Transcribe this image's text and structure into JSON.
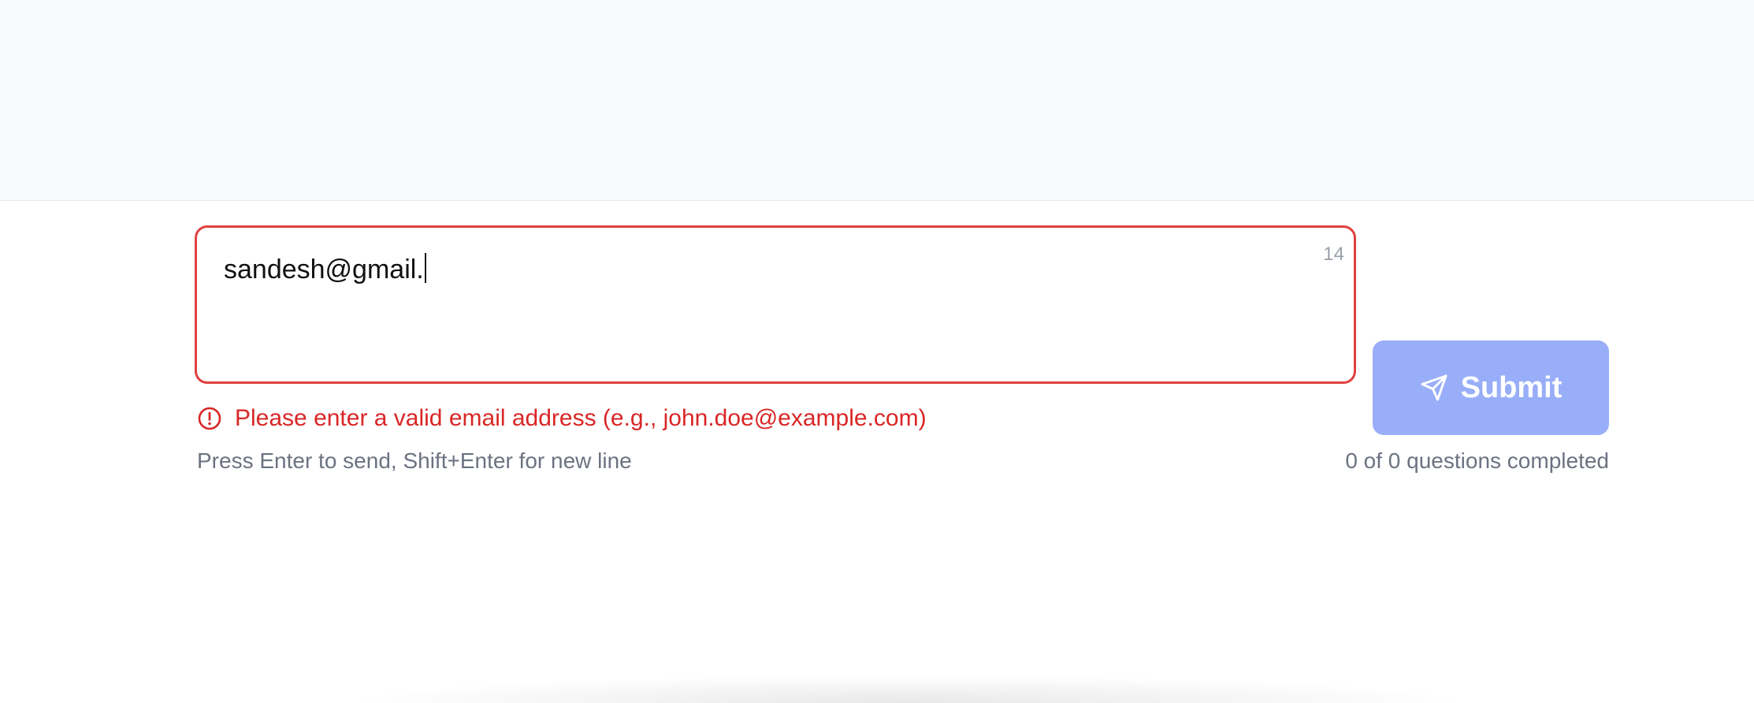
{
  "input": {
    "value": "sandesh@gmail.",
    "char_count": "14"
  },
  "error": {
    "icon": "alert-circle-icon",
    "message": "Please enter a valid email address (e.g., john.doe@example.com)",
    "color": "#d92626"
  },
  "hint": "Press Enter to send, Shift+Enter for new line",
  "progress": "0 of 0 questions completed",
  "submit": {
    "label": "Submit",
    "icon": "send-icon",
    "color": "#98aef8"
  }
}
